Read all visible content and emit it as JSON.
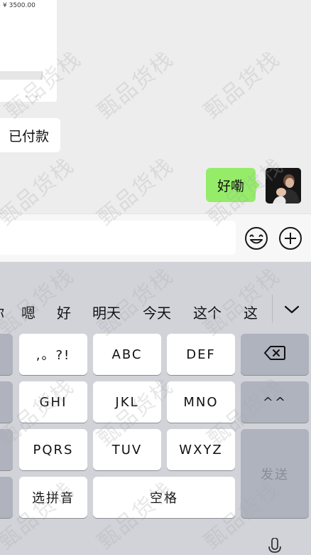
{
  "chat": {
    "order_card": {
      "price": "¥ 3500.00"
    },
    "messages": [
      {
        "side": "left",
        "text": "已付款"
      },
      {
        "side": "right",
        "text": "好嘞"
      }
    ]
  },
  "input_bar": {
    "emoji_icon": "smile-face-icon",
    "plus_icon": "circle-plus-icon"
  },
  "keyboard": {
    "candidates": [
      "你",
      "嗯",
      "好",
      "明天",
      "今天",
      "这个",
      "这"
    ],
    "rows": [
      [
        ",。?!",
        "ABC",
        "DEF"
      ],
      [
        "GHI",
        "JKL",
        "MNO"
      ],
      [
        "PQRS",
        "TUV",
        "WXYZ"
      ]
    ],
    "bottom": {
      "pinyin": "选拼音",
      "space": "空格"
    },
    "right_keys": {
      "backspace_icon": "backspace-icon",
      "emoticon": "^^",
      "send": "发送"
    }
  },
  "watermark": "甄品货栈",
  "colors": {
    "sent_bubble": "#95ec69",
    "keyboard_bg": "#d1d3d9",
    "function_key": "#aeb3be"
  }
}
